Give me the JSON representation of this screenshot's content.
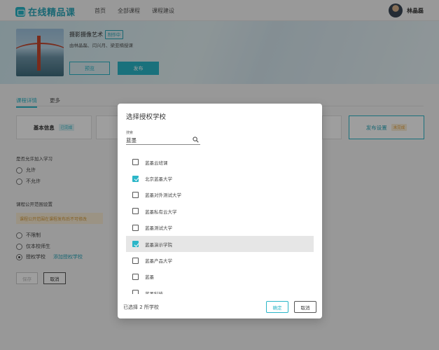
{
  "brand": {
    "name": "在线精品课",
    "accent": "#2bb6c8"
  },
  "nav": {
    "items": [
      "首页",
      "全部课程",
      "课程建设"
    ]
  },
  "user": {
    "name": "林晶磊"
  },
  "course": {
    "title": "摄影摄像艺术",
    "status_badge": "制作中",
    "teachers": "由林晶磊、闫兴月、梁亚楠授课",
    "preview_label": "预览",
    "publish_label": "发布"
  },
  "tabs": {
    "detail": "课程详情",
    "more": "更多"
  },
  "steps": {
    "basic_label": "基本信息",
    "basic_tag": "已完成",
    "mid_label": "",
    "right_label": "",
    "publish_label": "发布设置",
    "publish_tag": "未完成"
  },
  "settings": {
    "allow_join_label": "是否允许加入学习",
    "allow_options": [
      "允许",
      "不允许"
    ],
    "scope_label": "课程公开范围设置",
    "scope_warning": "课程公开范围在课程发布后不可修改",
    "scope_options": [
      "不限制",
      "仅本校师生",
      "授权学校"
    ],
    "add_school_link": "添加授权学校",
    "save_label": "保存",
    "cancel_label": "取消"
  },
  "dialog": {
    "title": "选择授权学校",
    "search_label": "搜索",
    "search_value": "蓝墨",
    "schools": [
      {
        "name": "蓝墨云班课",
        "checked": false,
        "highlight": false
      },
      {
        "name": "北京蓝墨大学",
        "checked": true,
        "highlight": false
      },
      {
        "name": "蓝墨对外测试大学",
        "checked": false,
        "highlight": false
      },
      {
        "name": "蓝墨私有云大学",
        "checked": false,
        "highlight": false
      },
      {
        "name": "蓝墨测试大学",
        "checked": false,
        "highlight": false
      },
      {
        "name": "蓝墨演示学院",
        "checked": true,
        "highlight": true
      },
      {
        "name": "蓝墨产品大学",
        "checked": false,
        "highlight": false
      },
      {
        "name": "蓝墨",
        "checked": false,
        "highlight": false
      },
      {
        "name": "蓝墨科技",
        "checked": false,
        "highlight": false
      }
    ],
    "selected_text": "已选择 2 所学校",
    "ok_label": "确定",
    "cancel_label": "取消"
  }
}
